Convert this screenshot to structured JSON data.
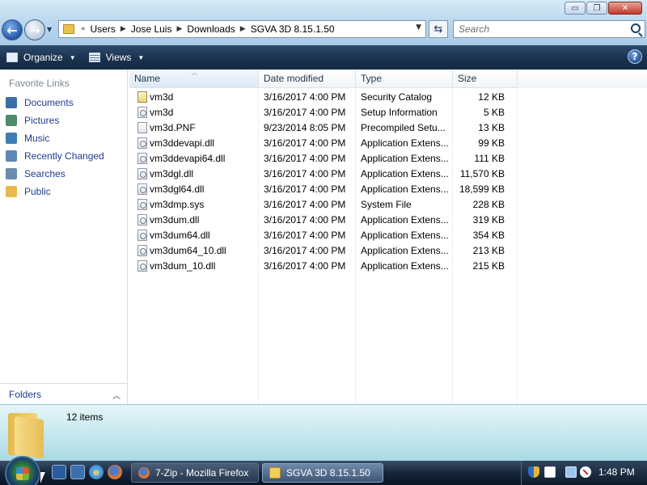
{
  "window": {
    "controls": {
      "minimize": "▭",
      "maximize": "❐",
      "close": "✕"
    }
  },
  "address": {
    "prefix": "«",
    "crumbs": [
      "Users",
      "Jose Luis",
      "Downloads",
      "SGVA 3D 8.15.1.50"
    ]
  },
  "search": {
    "placeholder": "Search"
  },
  "toolbar": {
    "organize": "Organize",
    "views": "Views",
    "help": "?"
  },
  "navpane": {
    "header": "Favorite Links",
    "items": [
      {
        "label": "Documents",
        "icon": "documents-icon",
        "color": "#3a6ea8"
      },
      {
        "label": "Pictures",
        "icon": "pictures-icon",
        "color": "#4f8a6d"
      },
      {
        "label": "Music",
        "icon": "music-icon",
        "color": "#3c7fb6"
      },
      {
        "label": "Recently Changed",
        "icon": "recent-icon",
        "color": "#5d87b8"
      },
      {
        "label": "Searches",
        "icon": "searches-icon",
        "color": "#6a8bb0"
      },
      {
        "label": "Public",
        "icon": "folder-icon",
        "color": "#e6b94a"
      }
    ],
    "folders": "Folders"
  },
  "columns": {
    "name": "Name",
    "date": "Date modified",
    "type": "Type",
    "size": "Size"
  },
  "files": [
    {
      "name": "vm3d",
      "date": "3/16/2017 4:00 PM",
      "type": "Security Catalog",
      "size": "12 KB",
      "icon": "catalog-icon"
    },
    {
      "name": "vm3d",
      "date": "3/16/2017 4:00 PM",
      "type": "Setup Information",
      "size": "5 KB",
      "icon": "setup-info-icon"
    },
    {
      "name": "vm3d.PNF",
      "date": "9/23/2014 8:05 PM",
      "type": "Precompiled Setu...",
      "size": "13 KB",
      "icon": "file-icon"
    },
    {
      "name": "vm3ddevapi.dll",
      "date": "3/16/2017 4:00 PM",
      "type": "Application Extens...",
      "size": "99 KB",
      "icon": "dll-icon"
    },
    {
      "name": "vm3ddevapi64.dll",
      "date": "3/16/2017 4:00 PM",
      "type": "Application Extens...",
      "size": "111 KB",
      "icon": "dll-icon"
    },
    {
      "name": "vm3dgl.dll",
      "date": "3/16/2017 4:00 PM",
      "type": "Application Extens...",
      "size": "11,570 KB",
      "icon": "dll-icon"
    },
    {
      "name": "vm3dgl64.dll",
      "date": "3/16/2017 4:00 PM",
      "type": "Application Extens...",
      "size": "18,599 KB",
      "icon": "dll-icon"
    },
    {
      "name": "vm3dmp.sys",
      "date": "3/16/2017 4:00 PM",
      "type": "System File",
      "size": "228 KB",
      "icon": "sys-icon"
    },
    {
      "name": "vm3dum.dll",
      "date": "3/16/2017 4:00 PM",
      "type": "Application Extens...",
      "size": "319 KB",
      "icon": "dll-icon"
    },
    {
      "name": "vm3dum64.dll",
      "date": "3/16/2017 4:00 PM",
      "type": "Application Extens...",
      "size": "354 KB",
      "icon": "dll-icon"
    },
    {
      "name": "vm3dum64_10.dll",
      "date": "3/16/2017 4:00 PM",
      "type": "Application Extens...",
      "size": "213 KB",
      "icon": "dll-icon"
    },
    {
      "name": "vm3dum_10.dll",
      "date": "3/16/2017 4:00 PM",
      "type": "Application Extens...",
      "size": "215 KB",
      "icon": "dll-icon"
    }
  ],
  "details": {
    "count": "12 items"
  },
  "taskbar": {
    "tasks": [
      {
        "label": "7-Zip - Mozilla Firefox"
      },
      {
        "label": "SGVA 3D 8.15.1.50"
      }
    ],
    "clock": "1:48 PM"
  }
}
